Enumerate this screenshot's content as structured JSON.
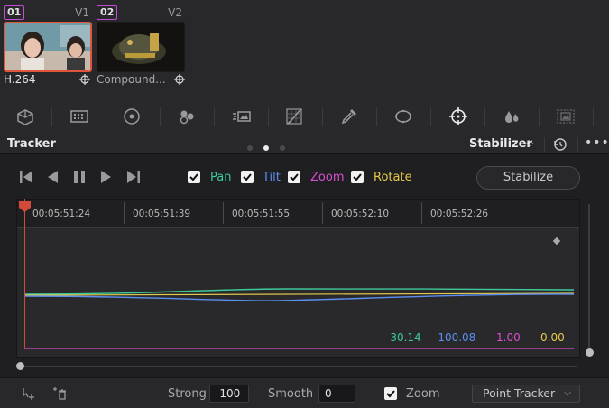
{
  "clips": [
    {
      "number": "01",
      "track": "V1",
      "name": "H.264",
      "selected": true
    },
    {
      "number": "02",
      "track": "V2",
      "name": "Compound...",
      "selected": false
    }
  ],
  "tools": [
    "camera-raw-icon",
    "color-match-icon",
    "color-wheels-icon",
    "rgb-mixer-icon",
    "motion-effects-icon",
    "curves-icon",
    "qualifier-icon",
    "window-icon",
    "tracker-icon",
    "blur-icon",
    "key-icon"
  ],
  "panel": {
    "title": "Tracker",
    "page_dots": 3,
    "active_dot": 1,
    "mode": "Stabilizer",
    "more": "•••"
  },
  "checks": [
    {
      "key": "pan",
      "label": "Pan",
      "checked": true,
      "color": "#3ec99b"
    },
    {
      "key": "tilt",
      "label": "Tilt",
      "checked": true,
      "color": "#5b8ef0"
    },
    {
      "key": "zoom",
      "label": "Zoom",
      "checked": true,
      "color": "#d94fcf"
    },
    {
      "key": "rotate",
      "label": "Rotate",
      "checked": true,
      "color": "#e2c94a"
    }
  ],
  "stabilize_button": "Stabilize",
  "timecodes": [
    "00:05:51:24",
    "00:05:51:39",
    "00:05:51:55",
    "00:05:52:10",
    "00:05:52:26"
  ],
  "readouts": {
    "pan": "-30.14",
    "tilt": "-100.08",
    "zoom": "1.00",
    "rotate": "0.00"
  },
  "bottom": {
    "strong_label": "Strong",
    "strong_value": "-100",
    "smooth_label": "Smooth",
    "smooth_value": "0",
    "zoom_label": "Zoom",
    "zoom_checked": true,
    "tracker_mode": "Point Tracker"
  },
  "colors": {
    "pan": "#3ec99b",
    "tilt": "#5b8ef0",
    "zoom": "#d94fcf",
    "rotate": "#e2c94a",
    "playhead": "#d24a3a",
    "selection": "#e0563b"
  }
}
